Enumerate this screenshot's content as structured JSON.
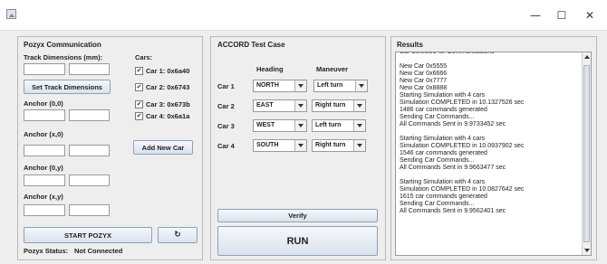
{
  "window": {
    "minimize_glyph": "—",
    "maximize_glyph": "☐",
    "close_glyph": "✕"
  },
  "pozyx": {
    "title": "Pozyx Communication",
    "track_label": "Track Dimensions (mm):",
    "set_track_button": "Set Track Dimensions",
    "anchor_00": "Anchor (0,0)",
    "anchor_x0": "Anchor (x,0)",
    "anchor_0y": "Anchor (0,y)",
    "anchor_xy": "Anchor (x,y)",
    "start_button": "START POZYX",
    "refresh_glyph": "↻",
    "status_label": "Pozyx Status:",
    "status_value": "Not Connected",
    "cars_label": "Cars:",
    "cars": [
      {
        "label": "Car 1: 0x6a40",
        "checked": true
      },
      {
        "label": "Car 2: 0x6743",
        "checked": true
      },
      {
        "label": "Car 3: 0x673b",
        "checked": true
      },
      {
        "label": "Car 4: 0x6a1a",
        "checked": true
      }
    ],
    "add_car_button": "Add New Car"
  },
  "accord": {
    "title": "ACCORD Test Case",
    "heading_header": "Heading",
    "maneuver_header": "Maneuver",
    "rows": [
      {
        "car": "Car 1",
        "heading": "NORTH",
        "maneuver": "Left turn"
      },
      {
        "car": "Car 2",
        "heading": "EAST",
        "maneuver": "Right turn"
      },
      {
        "car": "Car 3",
        "heading": "WEST",
        "maneuver": "Left turn"
      },
      {
        "car": "Car 4",
        "heading": "SOUTH",
        "maneuver": "Right turn"
      }
    ],
    "verify_button": "Verify",
    "run_button": "RUN"
  },
  "results": {
    "title": "Results",
    "lines": [
      "Car Selected for Communications",
      "",
      "New Car 0x5555",
      "New Car 0x6666",
      "New Car 0x7777",
      "New Car 0x8888",
      "Starting Simulation with 4 cars",
      "Simulation COMPLETED in 10.1327526 sec",
      "1486 car commands generated",
      "Sending Car Commands...",
      "All Commands Sent in 9.9733452 sec",
      "",
      "Starting Simulation with 4 cars",
      "Simulation COMPLETED in 10.0937902 sec",
      "1546 car commands generated",
      "Sending Car Commands...",
      "All Commands Sent in 9.9663477 sec",
      "",
      "Starting Simulation with 4 cars",
      "Simulation COMPLETED in 10.0827642 sec",
      "1615 car commands generated",
      "Sending Car Commands...",
      "All Commands Sent in 9.9562401 sec"
    ]
  }
}
